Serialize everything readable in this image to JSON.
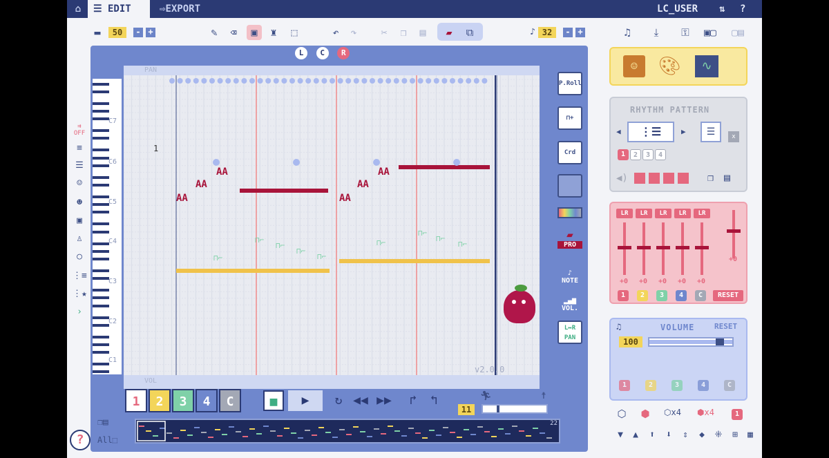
{
  "topbar": {
    "home_icon": "home-icon",
    "edit_label": "EDIT",
    "export_label": "EXPORT",
    "user_name": "LC_USER",
    "network_icon": "network-icon",
    "help_label": "?"
  },
  "toolbar": {
    "folder_icon": "folder-icon",
    "song_number": "50",
    "minus": "-",
    "plus": "+",
    "tools": [
      "pencil-icon",
      "eraser-icon",
      "stamp-icon",
      "paint-icon",
      "select-icon"
    ],
    "undo_icon": "undo-icon",
    "redo_icon": "redo-icon",
    "cut_icon": "cut-icon",
    "copy_icon": "copy-icon",
    "paste_icon": "paste-icon",
    "note_length_icon": "note-icon",
    "note_length": "32",
    "right_tools": [
      "note-list-icon",
      "download-icon",
      "lock-icon",
      "view-icon",
      "window-icon"
    ]
  },
  "editor": {
    "lcr": [
      "L",
      "C",
      "R"
    ],
    "pan_label": "PAN",
    "vol_label": "VOL",
    "measure_number": "1",
    "version": "v2.0.0",
    "octave_labels": [
      "C7",
      "C6",
      "C5",
      "C4",
      "C3",
      "C2",
      "C1"
    ],
    "side_tools": [
      {
        "name": "piano-roll",
        "label": "P.Roll"
      },
      {
        "name": "note-add",
        "label": "⊓+"
      },
      {
        "name": "chord",
        "label": "Crd"
      },
      {
        "name": "layers",
        "label": ""
      },
      {
        "name": "color-bar",
        "label": ""
      },
      {
        "name": "pro",
        "label": "PRO"
      },
      {
        "name": "note-mode",
        "label": "NOTE"
      },
      {
        "name": "vol-mode",
        "label": "VOL."
      },
      {
        "name": "pan-mode",
        "label": "PAN"
      }
    ]
  },
  "tracks": {
    "buttons": [
      "1",
      "2",
      "3",
      "4",
      "C"
    ],
    "colors": [
      "#e5687e",
      "#f3d55a",
      "#7fd1a8",
      "#6f87cd",
      "#a3a8b5"
    ],
    "measure_count": "11",
    "minimap_end": "22"
  },
  "right_panel": {
    "rhythm_title": "RHYTHM PATTERN",
    "rhythm_chips": [
      "1",
      "2",
      "3",
      "4"
    ],
    "mixer_lr": [
      "LR",
      "LR",
      "LR",
      "LR",
      "LR"
    ],
    "mixer_values": [
      "+0",
      "+0",
      "+0",
      "+0",
      "+0"
    ],
    "master_value": "+0",
    "reset_label": "RESET",
    "volume_title": "VOLUME",
    "volume_reset": "RESET",
    "volume_value": "100",
    "channel_chips": [
      "1",
      "2",
      "3",
      "4",
      "C"
    ]
  },
  "bottom_icons": [
    "dice-icon",
    "dice-red-icon",
    "dice-x4-icon",
    "dice-red-x4-icon",
    "track-1-chip"
  ],
  "bottom_icons2": [
    "octave-down-icon",
    "octave-up-icon",
    "up-arrow-icon",
    "down-arrow-icon",
    "updown-icon",
    "diamond-icon",
    "scatter-icon",
    "align-icon",
    "grid-icon"
  ]
}
